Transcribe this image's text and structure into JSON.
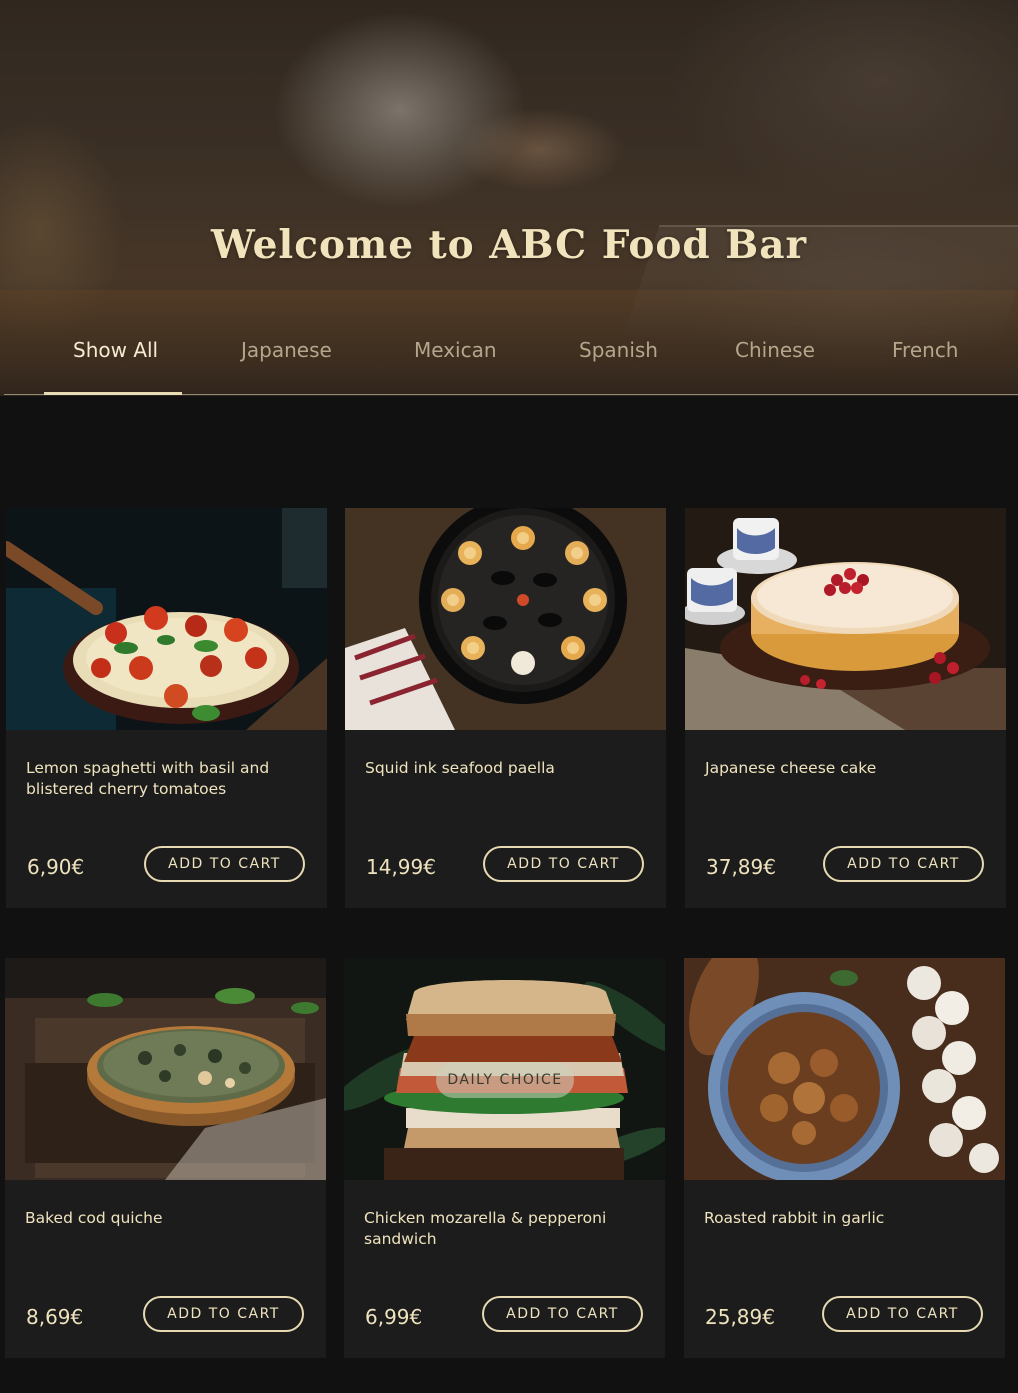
{
  "hero": {
    "title": "Welcome to ABC Food Bar"
  },
  "tabs": [
    {
      "label": "Show All",
      "active": true
    },
    {
      "label": "Japanese",
      "active": false
    },
    {
      "label": "Mexican",
      "active": false
    },
    {
      "label": "Spanish",
      "active": false
    },
    {
      "label": "Chinese",
      "active": false
    },
    {
      "label": "French",
      "active": false
    }
  ],
  "products": [
    {
      "name": "Lemon spaghetti with basil and blistered cherry tomatoes",
      "price": "6,90€",
      "button": "ADD TO CART"
    },
    {
      "name": "Squid ink seafood paella",
      "price": "14,99€",
      "button": "ADD TO CART"
    },
    {
      "name": "Japanese cheese cake",
      "price": "37,89€",
      "button": "ADD TO CART"
    },
    {
      "name": "Baked cod quiche",
      "price": "8,69€",
      "button": "ADD TO CART"
    },
    {
      "name": "Chicken mozarella & pepperoni sandwich",
      "price": "6,99€",
      "button": "ADD TO CART",
      "badge": "DAILY CHOICE"
    },
    {
      "name": "Roasted rabbit in garlic",
      "price": "25,89€",
      "button": "ADD TO CART"
    }
  ],
  "colors": {
    "background": "#111111",
    "card": "#1c1c1c",
    "accent": "#efe3be"
  }
}
